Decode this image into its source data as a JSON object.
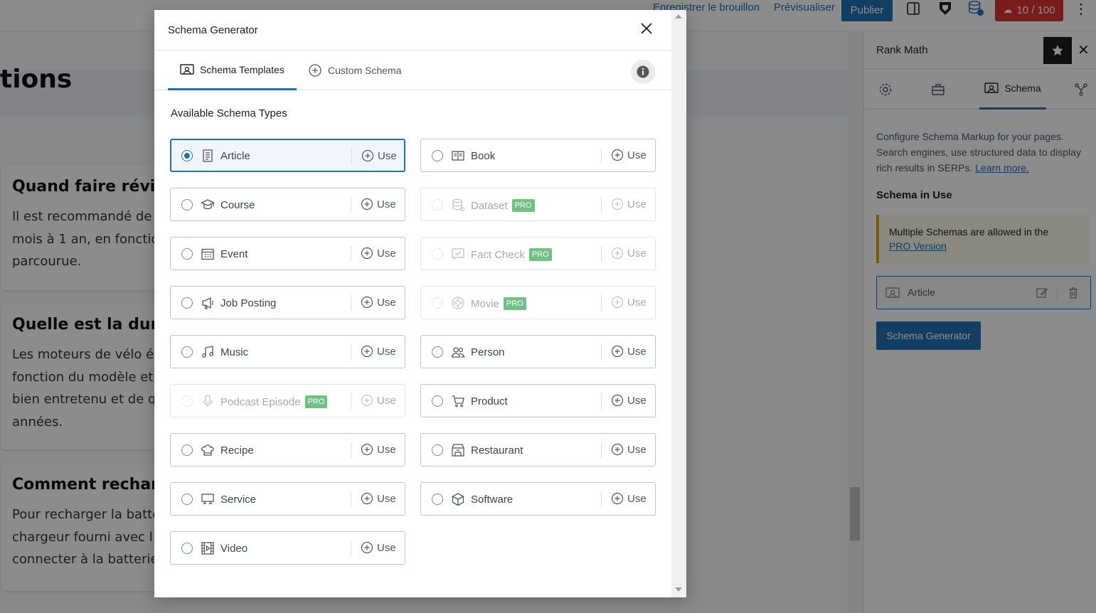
{
  "topbar": {
    "save_draft": "Enregistrer le brouillon",
    "preview": "Prévisualiser",
    "publish": "Publier",
    "score": "10 / 100",
    "more": "⋮"
  },
  "content": {
    "hero_title": "tions",
    "faq": [
      {
        "question": "Quand faire révisi",
        "answer": [
          "Il est recommandé de",
          "mois à 1 an, en fonctio",
          "parcourue."
        ]
      },
      {
        "question": "Quelle est la duré",
        "answer": [
          "Les moteurs de vélo él",
          "fonction du modèle et",
          "bien entretenu et de q",
          "années."
        ]
      },
      {
        "question": "Comment recharg",
        "answer": [
          "Pour recharger la batte",
          "chargeur fourni avec l",
          "connecter à la batterie"
        ]
      }
    ]
  },
  "sidebar": {
    "title": "Rank Math",
    "close": "✕",
    "active_tab": "Schema",
    "description": "Configure Schema Markup for your pages. Search engines, use structured data to display rich results in SERPs.",
    "learn_more": "Learn more.",
    "schema_in_use": "Schema in Use",
    "notice_text": "Multiple Schemas are allowed in the",
    "notice_link": "PRO Version",
    "article": "Article",
    "generator_button": "Schema Generator"
  },
  "modal": {
    "title": "Schema Generator",
    "tabs": [
      "Schema Templates",
      "Custom Schema"
    ],
    "active_tab": "Schema Templates",
    "heading": "Available Schema Types",
    "use_label": "Use",
    "pro_label": "PRO",
    "types": [
      {
        "label": "Article",
        "icon": "article-icon",
        "selected": true,
        "pro": false
      },
      {
        "label": "Book",
        "icon": "book-icon",
        "selected": false,
        "pro": false
      },
      {
        "label": "Course",
        "icon": "course-icon",
        "selected": false,
        "pro": false
      },
      {
        "label": "Dataset",
        "icon": "dataset-icon",
        "selected": false,
        "pro": true
      },
      {
        "label": "Event",
        "icon": "event-icon",
        "selected": false,
        "pro": false
      },
      {
        "label": "Fact Check",
        "icon": "fact-check-icon",
        "selected": false,
        "pro": true
      },
      {
        "label": "Job Posting",
        "icon": "job-posting-icon",
        "selected": false,
        "pro": false
      },
      {
        "label": "Movie",
        "icon": "movie-icon",
        "selected": false,
        "pro": true
      },
      {
        "label": "Music",
        "icon": "music-icon",
        "selected": false,
        "pro": false
      },
      {
        "label": "Person",
        "icon": "person-icon",
        "selected": false,
        "pro": false
      },
      {
        "label": "Podcast Episode",
        "icon": "podcast-icon",
        "selected": false,
        "pro": true
      },
      {
        "label": "Product",
        "icon": "product-icon",
        "selected": false,
        "pro": false
      },
      {
        "label": "Recipe",
        "icon": "recipe-icon",
        "selected": false,
        "pro": false
      },
      {
        "label": "Restaurant",
        "icon": "restaurant-icon",
        "selected": false,
        "pro": false
      },
      {
        "label": "Service",
        "icon": "service-icon",
        "selected": false,
        "pro": false
      },
      {
        "label": "Software",
        "icon": "software-icon",
        "selected": false,
        "pro": false
      },
      {
        "label": "Video",
        "icon": "video-icon",
        "selected": false,
        "pro": false
      }
    ]
  },
  "colors": {
    "accent": "#2271b1",
    "pro_badge": "#4fb463",
    "score_bad": "#dc3232",
    "notice_border": "#dba617"
  }
}
